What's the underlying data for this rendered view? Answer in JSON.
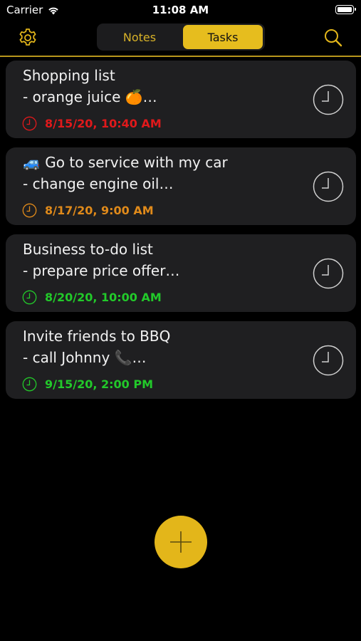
{
  "status_bar": {
    "carrier": "Carrier",
    "time": "11:08 AM"
  },
  "nav": {
    "settings_icon": "gear-icon",
    "search_icon": "search-icon",
    "segments": [
      {
        "label": "Notes",
        "selected": false
      },
      {
        "label": "Tasks",
        "selected": true
      }
    ]
  },
  "colors": {
    "accent": "#e6bd1e",
    "overdue": "#e0191b",
    "upcoming": "#e08a1a",
    "scheduled": "#22c92a"
  },
  "tasks": [
    {
      "title": "Shopping list",
      "subtitle": "- orange juice 🍊…",
      "date": "8/15/20, 10:40 AM",
      "status": "overdue",
      "date_color": "#e0191b"
    },
    {
      "title": "🚙 Go to service with my car",
      "subtitle": "- change engine oil…",
      "date": "8/17/20, 9:00 AM",
      "status": "upcoming",
      "date_color": "#e08a1a"
    },
    {
      "title": "Business to-do list",
      "subtitle": "- prepare price offer…",
      "date": "8/20/20, 10:00 AM",
      "status": "scheduled",
      "date_color": "#22c92a"
    },
    {
      "title": "Invite friends to BBQ",
      "subtitle": "- call Johnny 📞…",
      "date": "9/15/20, 2:00 PM",
      "status": "scheduled",
      "date_color": "#22c92a"
    }
  ],
  "fab_icon": "plus-icon"
}
